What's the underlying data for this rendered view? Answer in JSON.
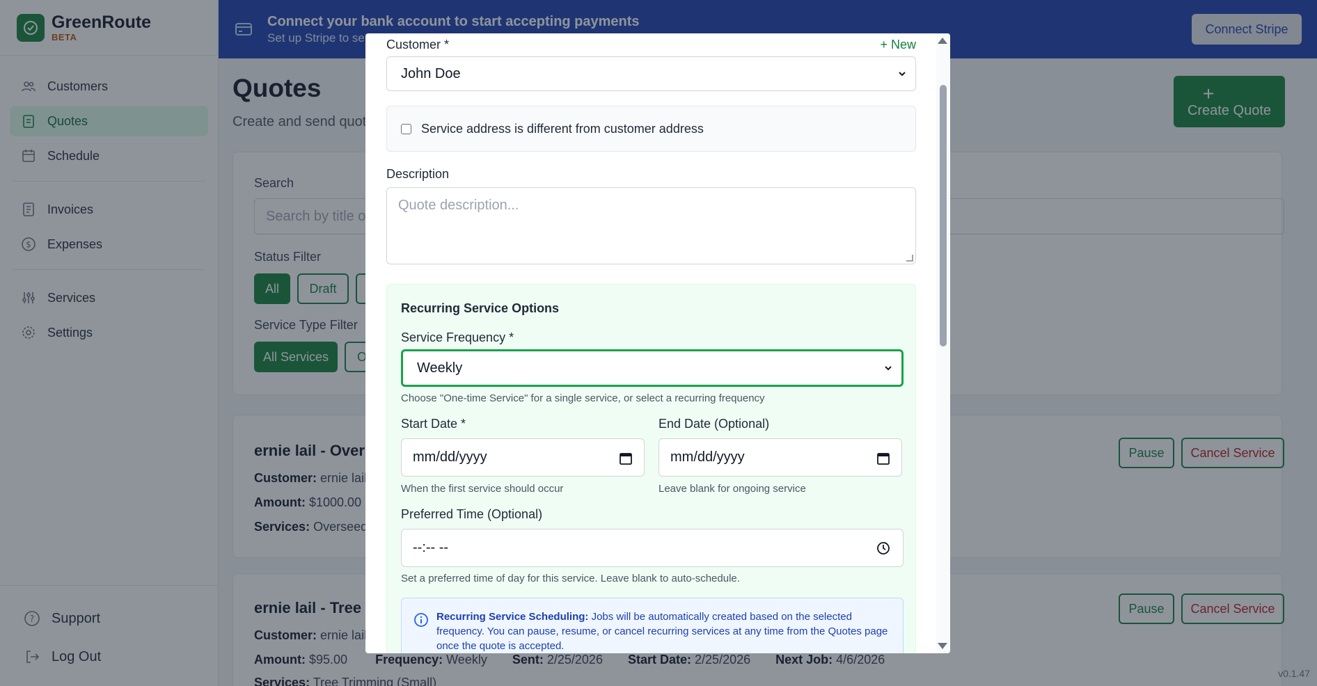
{
  "brand": {
    "name": "GreenRoute",
    "tag": "BETA"
  },
  "sidebar": {
    "items": [
      {
        "label": "Customers",
        "icon": "users-icon"
      },
      {
        "label": "Quotes",
        "icon": "clipboard-icon"
      },
      {
        "label": "Schedule",
        "icon": "calendar-icon"
      },
      {
        "label": "Invoices",
        "icon": "document-icon"
      },
      {
        "label": "Expenses",
        "icon": "dollar-icon"
      },
      {
        "label": "Services",
        "icon": "sliders-icon"
      },
      {
        "label": "Settings",
        "icon": "gear-icon"
      }
    ],
    "support": "Support",
    "logout": "Log Out"
  },
  "banner": {
    "title": "Connect your bank account to start accepting payments",
    "subtitle": "Set up Stripe to sen",
    "button": "Connect Stripe"
  },
  "page": {
    "title": "Quotes",
    "subtitle": "Create and send quot",
    "create_button": "Create Quote",
    "search_label": "Search",
    "search_placeholder": "Search by title o",
    "status_filter_label": "Status Filter",
    "status_chips": [
      "All",
      "Draft"
    ],
    "service_filter_label": "Service Type Filter",
    "service_chips": [
      "All Services",
      "O"
    ]
  },
  "quotes": [
    {
      "title": "ernie lail - Overs",
      "customer_label": "Customer:",
      "customer": "ernie lail",
      "amount_label": "Amount:",
      "amount": "$1000.00",
      "services_label": "Services:",
      "services": "Overseedin",
      "pause": "Pause",
      "cancel": "Cancel Service"
    },
    {
      "title": "ernie lail - Tree T",
      "customer_label": "Customer:",
      "customer": "ernie lail",
      "amount_label": "Amount:",
      "amount": "$95.00",
      "frequency_label": "Frequency:",
      "frequency": "Weekly",
      "sent_label": "Sent:",
      "sent": "2/25/2026",
      "start_label": "Start Date:",
      "start": "2/25/2026",
      "next_label": "Next Job:",
      "next": "4/6/2026",
      "services_label": "Services:",
      "services": "Tree Trimming (Small)",
      "pause": "Pause",
      "cancel": "Cancel Service"
    }
  ],
  "version": "v0.1.47",
  "modal": {
    "customer_label": "Customer *",
    "new_link": "+ New",
    "customer_value": "John Doe",
    "address_checkbox_label": "Service address is different from customer address",
    "description_label": "Description",
    "description_placeholder": "Quote description...",
    "recurring": {
      "title": "Recurring Service Options",
      "frequency_label": "Service Frequency *",
      "frequency_value": "Weekly",
      "frequency_hint": "Choose \"One-time Service\" for a single service, or select a recurring frequency",
      "start_label": "Start Date *",
      "start_value": "mm/dd/yyyy",
      "start_hint": "When the first service should occur",
      "end_label": "End Date (Optional)",
      "end_value": "mm/dd/yyyy",
      "end_hint": "Leave blank for ongoing service",
      "time_label": "Preferred Time (Optional)",
      "time_value": "--:-- --",
      "time_hint": "Set a preferred time of day for this service. Leave blank to auto-schedule.",
      "info_title": "Recurring Service Scheduling:",
      "info_text": " Jobs will be automatically created based on the selected frequency. You can pause, resume, or cancel recurring services at any time from the Quotes page once the quote is accepted."
    }
  },
  "colors": {
    "brand": "#15803d",
    "banner": "#1e40af",
    "danger": "#b91c1c"
  }
}
